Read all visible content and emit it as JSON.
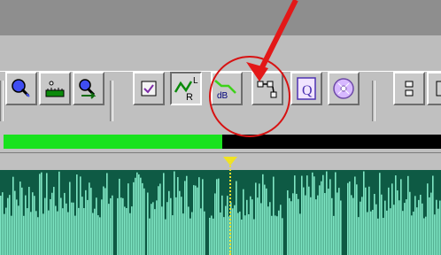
{
  "window": {
    "title": ""
  },
  "toolbar": {
    "buttons": [
      {
        "name": "zoom-in-button",
        "icon": "magnify-icon"
      },
      {
        "name": "zoom-extent-button",
        "icon": "ruler-icon"
      },
      {
        "name": "zoom-out-button",
        "icon": "arrow-magnify-icon"
      },
      {
        "name": "checkbox-button",
        "icon": "checkbox-icon"
      },
      {
        "name": "rl-envelope-button",
        "icon": "envelope-icon"
      },
      {
        "name": "db-envelope-button",
        "icon": "db-envelope-icon"
      },
      {
        "name": "points-envelope-button",
        "icon": "points-icon"
      },
      {
        "name": "query-button",
        "icon": "q-document-icon"
      },
      {
        "name": "disc-button",
        "icon": "disc-icon"
      },
      {
        "name": "panel-button",
        "icon": "panel-icon"
      }
    ]
  },
  "progress": {
    "value": 0.5
  },
  "annotations": {
    "circle_color": "#d71212",
    "arrow_color": "#d71212"
  }
}
